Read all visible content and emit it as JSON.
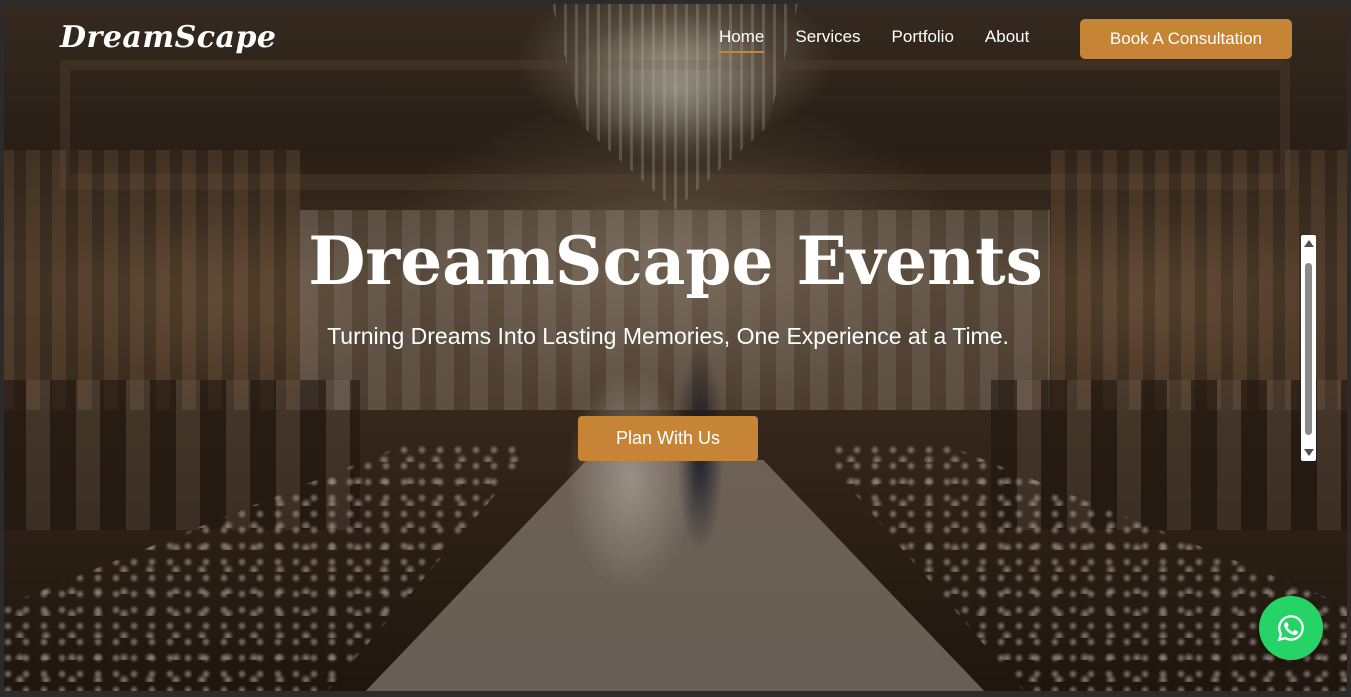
{
  "brand": {
    "logo_text": "DreamScape"
  },
  "nav": {
    "items": [
      {
        "label": "Home",
        "active": true
      },
      {
        "label": "Services",
        "active": false
      },
      {
        "label": "Portfolio",
        "active": false
      },
      {
        "label": "About",
        "active": false
      }
    ],
    "cta_label": "Book A Consultation"
  },
  "hero": {
    "title": "DreamScape Events",
    "subtitle": "Turning Dreams Into Lasting Memories, One Experience at a Time.",
    "cta_label": "Plan With Us",
    "background": "wedding-ballroom-photo"
  },
  "widgets": {
    "whatsapp_icon": "whatsapp-icon"
  },
  "colors": {
    "accent": "#c58436",
    "whatsapp": "#25d366",
    "text": "#ffffff"
  }
}
